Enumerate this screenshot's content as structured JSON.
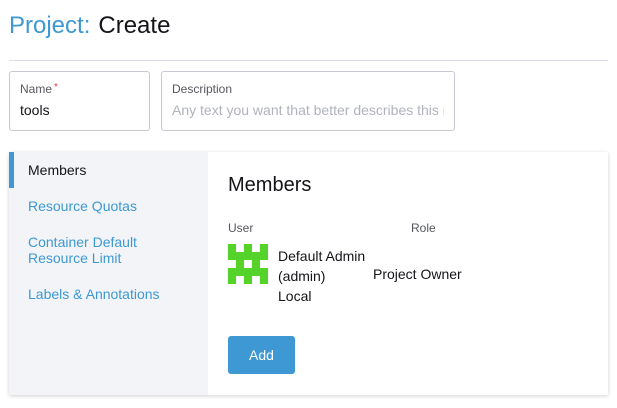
{
  "header": {
    "crumb": "Project:",
    "title": "Create"
  },
  "form": {
    "name": {
      "label": "Name",
      "required_mark": "*",
      "value": "tools"
    },
    "description": {
      "label": "Description",
      "placeholder": "Any text you want that better describes this r",
      "value": ""
    }
  },
  "tabs": [
    {
      "label": "Members",
      "active": true
    },
    {
      "label": "Resource Quotas",
      "active": false
    },
    {
      "label": "Container Default Resource Limit",
      "active": false
    },
    {
      "label": "Labels & Annotations",
      "active": false
    }
  ],
  "members": {
    "heading": "Members",
    "columns": {
      "user": "User",
      "role": "Role"
    },
    "rows": [
      {
        "name": "Default Admin",
        "username": "(admin)",
        "provider": "Local",
        "role": "Project Owner",
        "avatar_icon": "identicon-avatar",
        "avatar_color": "#56d32a"
      }
    ],
    "add_label": "Add"
  },
  "colors": {
    "accent": "#3d98d3",
    "border": "#c6c9d3",
    "tabs_bg": "#f3f4f8"
  }
}
